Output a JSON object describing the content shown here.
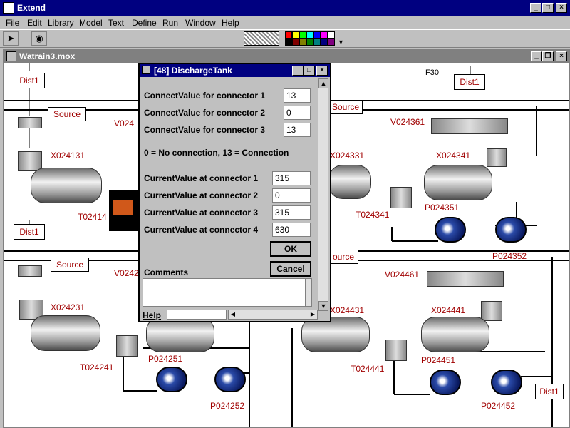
{
  "app": {
    "title": "Extend"
  },
  "menu": [
    "File",
    "Edit",
    "Library",
    "Model",
    "Text",
    "Define",
    "Run",
    "Window",
    "Help"
  ],
  "document": {
    "title": "Watrain3.mox"
  },
  "model": {
    "labels_top": {
      "dist1_a": "Dist1",
      "source_a": "Source",
      "v024": "V024",
      "x024131": "X024131",
      "t02414": "T02414",
      "x024331": "X024331",
      "x024341": "X024341",
      "t024341": "T024341",
      "p024351": "P024351",
      "v024361": "V024361",
      "source_b": "Source",
      "f30": "F30",
      "dist1_b": "Dist1",
      "p024352": "P024352"
    },
    "labels_bottom": {
      "dist1_c": "Dist1",
      "source_c": "Source",
      "v0242": "V0242",
      "x024231": "X024231",
      "t024241": "T024241",
      "p024251": "P024251",
      "p024252": "P024252",
      "source_d": "ource",
      "v024461": "V024461",
      "x024431": "X024431",
      "x024441": "X024441",
      "t024441": "T024441",
      "p024451": "P024451",
      "p024452": "P024452",
      "dist1_d": "Dist1"
    }
  },
  "dialog": {
    "title": "[48]  DischargeTank",
    "connect_rows": [
      {
        "label": "ConnectValue for connector 1",
        "value": "13"
      },
      {
        "label": "ConnectValue for connector 2",
        "value": "0"
      },
      {
        "label": "ConnectValue for connector 3",
        "value": "13"
      }
    ],
    "legend": "0 = No connection, 13 = Connection",
    "current_rows": [
      {
        "label": "CurrentValue at connector 1",
        "value": "315"
      },
      {
        "label": "CurrentValue at connector 2",
        "value": "0"
      },
      {
        "label": "CurrentValue at connector 3",
        "value": "315"
      },
      {
        "label": "CurrentValue at connector 4",
        "value": "630"
      }
    ],
    "ok_label": "OK",
    "cancel_label": "Cancel",
    "comments_label": "Comments",
    "help_label": "Help"
  },
  "colors": {
    "titlebar": "#000080",
    "label_red": "#a00000",
    "pump_blue": "#2a4aa8"
  },
  "palette": [
    "#ff0000",
    "#ffff00",
    "#00ff00",
    "#00ffff",
    "#0000ff",
    "#ff00ff",
    "#ffffff",
    "#000000",
    "#800000",
    "#808000",
    "#008000",
    "#008080",
    "#000080",
    "#800080"
  ]
}
